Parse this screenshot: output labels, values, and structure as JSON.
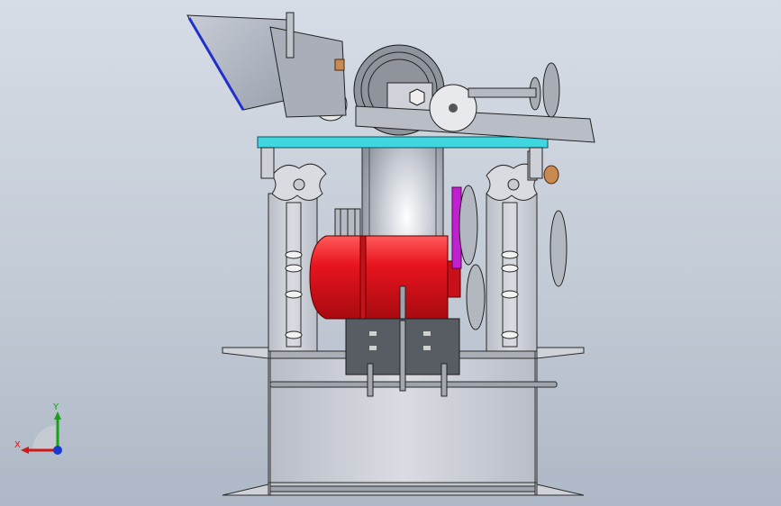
{
  "viewport": {
    "background_top": "#d7dde6",
    "background_bottom": "#aeb8c6"
  },
  "model": {
    "motor_color": "#e8141e",
    "table_color": "#3fd6e0",
    "belt_color": "#c020d0",
    "frame_color": "#c9ccd3"
  },
  "triad": {
    "x_label": "X",
    "y_label": "Y",
    "x_color": "#d01818",
    "y_color": "#18a018",
    "z_color": "#1838d0"
  }
}
